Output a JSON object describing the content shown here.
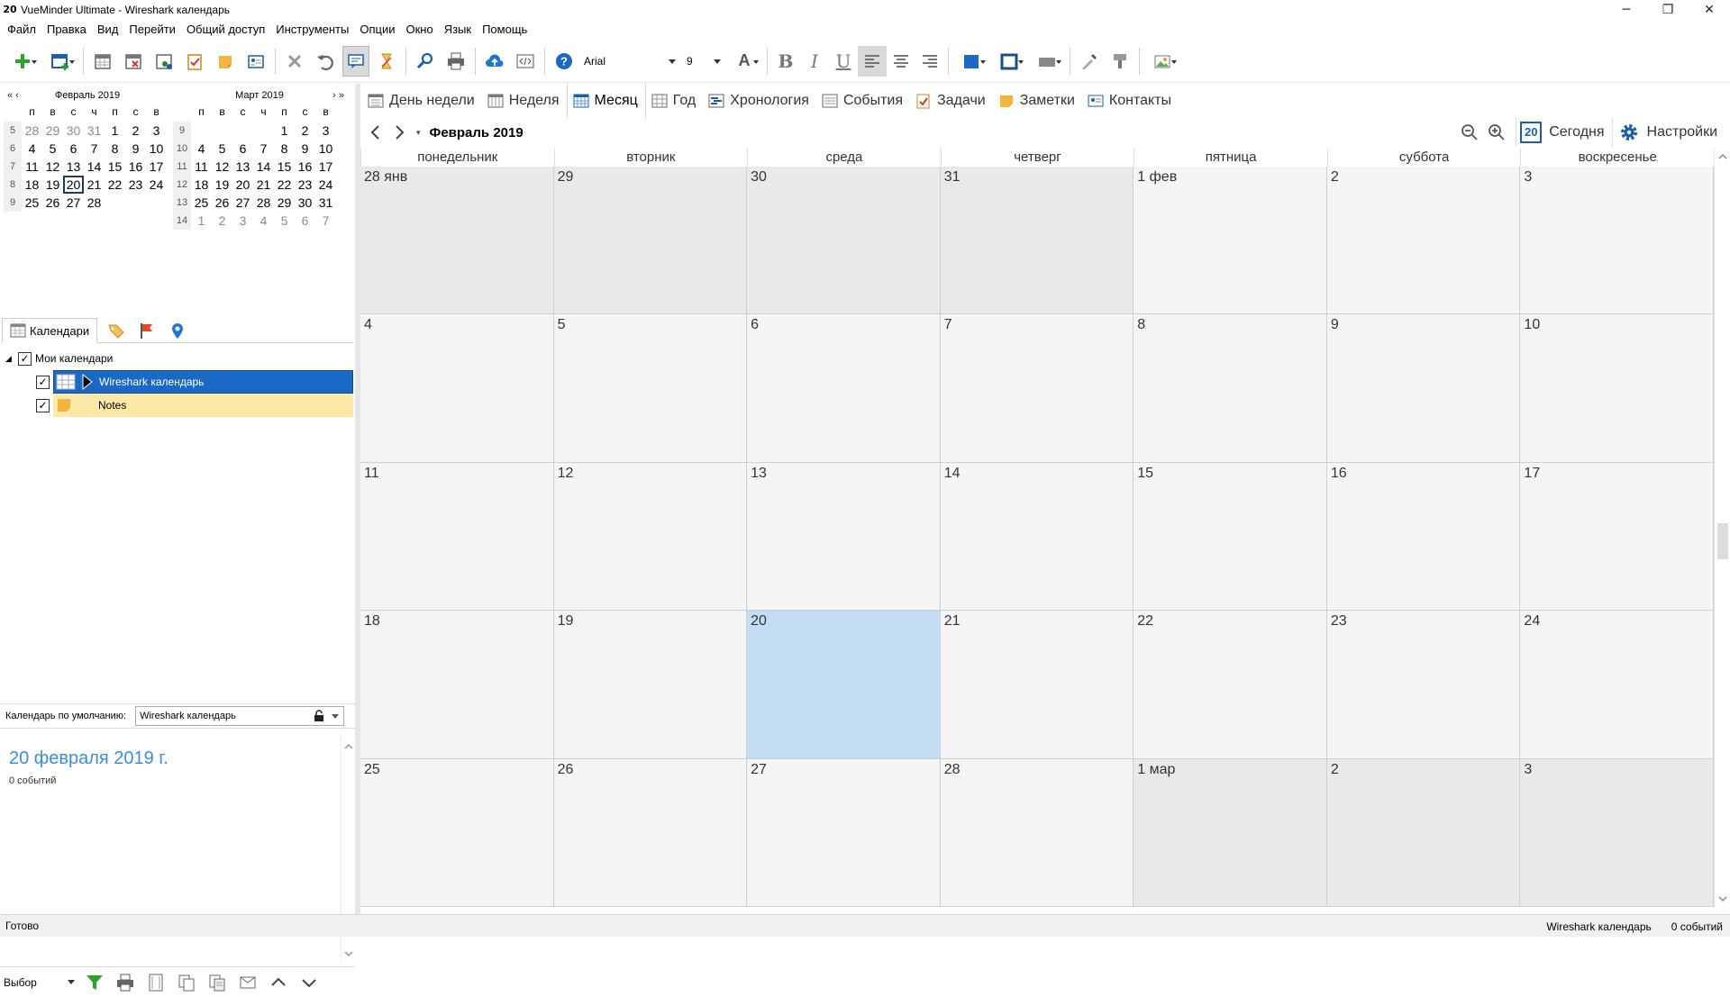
{
  "window": {
    "icon_text": "20",
    "title": "VueMinder Ultimate - Wireshark календарь",
    "controls": [
      "─",
      "❐",
      "✕"
    ]
  },
  "menu": [
    "Файл",
    "Правка",
    "Вид",
    "Перейти",
    "Общий доступ",
    "Инструменты",
    "Опции",
    "Окно",
    "Язык",
    "Помощь"
  ],
  "toolbar": {
    "font_name": "Arial",
    "font_size": "9",
    "bold": "B",
    "italic": "I",
    "underline": "U",
    "font_color": "A"
  },
  "mini_calendars": [
    {
      "title": "Февраль 2019",
      "nav_left": "«  ‹",
      "dow": [
        "п",
        "в",
        "с",
        "ч",
        "п",
        "с",
        "в"
      ],
      "weeks": [
        {
          "wk": "5",
          "days": [
            "28",
            "29",
            "30",
            "31",
            "1",
            "2",
            "3"
          ],
          "other": [
            true,
            true,
            true,
            true,
            false,
            false,
            false
          ]
        },
        {
          "wk": "6",
          "days": [
            "4",
            "5",
            "6",
            "7",
            "8",
            "9",
            "10"
          ],
          "other": [
            false,
            false,
            false,
            false,
            false,
            false,
            false
          ]
        },
        {
          "wk": "7",
          "days": [
            "11",
            "12",
            "13",
            "14",
            "15",
            "16",
            "17"
          ],
          "other": [
            false,
            false,
            false,
            false,
            false,
            false,
            false
          ]
        },
        {
          "wk": "8",
          "days": [
            "18",
            "19",
            "20",
            "21",
            "22",
            "23",
            "24"
          ],
          "other": [
            false,
            false,
            false,
            false,
            false,
            false,
            false
          ]
        },
        {
          "wk": "9",
          "days": [
            "25",
            "26",
            "27",
            "28",
            "",
            "",
            ""
          ],
          "other": [
            false,
            false,
            false,
            false,
            false,
            false,
            false
          ]
        }
      ],
      "today": "20"
    },
    {
      "title": "Март 2019",
      "nav_right": "›  »",
      "dow": [
        "п",
        "в",
        "с",
        "ч",
        "п",
        "с",
        "в"
      ],
      "weeks": [
        {
          "wk": "9",
          "days": [
            "",
            "",
            "",
            "",
            "1",
            "2",
            "3"
          ],
          "other": [
            false,
            false,
            false,
            false,
            false,
            false,
            false
          ]
        },
        {
          "wk": "10",
          "days": [
            "4",
            "5",
            "6",
            "7",
            "8",
            "9",
            "10"
          ],
          "other": [
            false,
            false,
            false,
            false,
            false,
            false,
            false
          ]
        },
        {
          "wk": "11",
          "days": [
            "11",
            "12",
            "13",
            "14",
            "15",
            "16",
            "17"
          ],
          "other": [
            false,
            false,
            false,
            false,
            false,
            false,
            false
          ]
        },
        {
          "wk": "12",
          "days": [
            "18",
            "19",
            "20",
            "21",
            "22",
            "23",
            "24"
          ],
          "other": [
            false,
            false,
            false,
            false,
            false,
            false,
            false
          ]
        },
        {
          "wk": "13",
          "days": [
            "25",
            "26",
            "27",
            "28",
            "29",
            "30",
            "31"
          ],
          "other": [
            false,
            false,
            false,
            false,
            false,
            false,
            false
          ]
        },
        {
          "wk": "14",
          "days": [
            "1",
            "2",
            "3",
            "4",
            "5",
            "6",
            "7"
          ],
          "other": [
            true,
            true,
            true,
            true,
            true,
            true,
            true
          ]
        }
      ]
    }
  ],
  "left_tabs": {
    "calendars": "Календари"
  },
  "tree": {
    "root": "Мои календари",
    "items": [
      "Wireshark календарь",
      "Notes"
    ]
  },
  "default_calendar": {
    "label": "Календарь по умолчанию:",
    "value": "Wireshark календарь"
  },
  "agenda": {
    "date": "20 февраля 2019 г.",
    "count": "0 событий"
  },
  "bottom": {
    "view_select": "Выбор"
  },
  "view_tabs": [
    "День недели",
    "Неделя",
    "Месяц",
    "Год",
    "Хронология",
    "События",
    "Задачи",
    "Заметки",
    "Контакты"
  ],
  "active_view": 2,
  "nav": {
    "month_title": "Февраль 2019",
    "today_label": "Сегодня",
    "today_num": "20",
    "settings_label": "Настройки",
    "drop": "▾"
  },
  "month": {
    "dow": [
      "понедельник",
      "вторник",
      "среда",
      "четверг",
      "пятница",
      "суббота",
      "воскресенье"
    ],
    "cells": [
      "28 янв",
      "29",
      "30",
      "31",
      "1 фев",
      "2",
      "3",
      "4",
      "5",
      "6",
      "7",
      "8",
      "9",
      "10",
      "11",
      "12",
      "13",
      "14",
      "15",
      "16",
      "17",
      "18",
      "19",
      "20",
      "21",
      "22",
      "23",
      "24",
      "25",
      "26",
      "27",
      "28",
      "1 мар",
      "2",
      "3"
    ],
    "out_of_month": [
      0,
      1,
      2,
      3,
      32,
      33,
      34
    ],
    "today_index": 23
  },
  "status": {
    "left": "Готово",
    "calendar": "Wireshark календарь",
    "count": "0 событий"
  },
  "colors": {
    "accent": "#1b69c4",
    "today": "#c3dcf3",
    "notes": "#fde9a7",
    "agenda_date": "#3a8fd8"
  }
}
